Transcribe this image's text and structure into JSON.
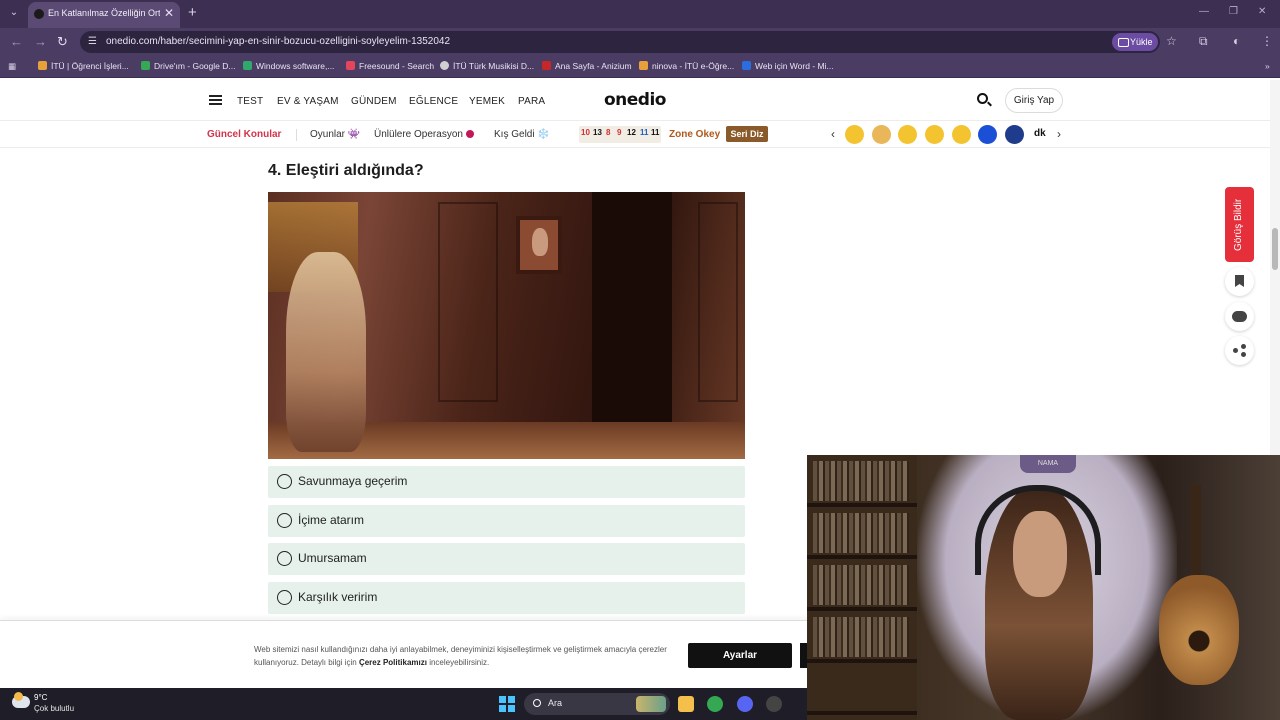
{
  "browser": {
    "tab_title": "En Katlanılmaz Özelliğin Ortaya",
    "tab_close": "✕",
    "new_tab": "+",
    "url": "onedio.com/haber/secimini-yap-en-sinir-bozucu-ozelligini-soyleyelim-1352042",
    "upload_label": "Yükle",
    "bookmarks": [
      {
        "label": "İTÜ | Öğrenci İşleri...",
        "color": "#e8a13a"
      },
      {
        "label": "Drive'ım - Google D...",
        "color": "#34a853"
      },
      {
        "label": "Windows software,...",
        "color": "#2ea86b"
      },
      {
        "label": "Freesound - Search",
        "color": "#e2455c"
      },
      {
        "label": "İTÜ Türk Musikisi D...",
        "color": "#d0d0d0"
      },
      {
        "label": "Ana Sayfa - Anizium",
        "color": "#c62828"
      },
      {
        "label": "ninova - İTÜ e-Öğre...",
        "color": "#e8a13a"
      },
      {
        "label": "Web için Word - Mi...",
        "color": "#2b6de0"
      }
    ]
  },
  "site": {
    "logo": "onedio",
    "nav": [
      "TEST",
      "EV & YAŞAM",
      "GÜNDEM",
      "EĞLENCE",
      "YEMEK",
      "PARA"
    ],
    "login_label": "Giriş Yap",
    "subnav": {
      "current_topics": "Güncel Konular",
      "games": "Oyunlar 👾",
      "celebrity_op": "Ünlülere Operasyon",
      "winter": "Kış Geldi ❄️",
      "okey_tiles": [
        {
          "n": "10",
          "c": "#d32f2f"
        },
        {
          "n": "13",
          "c": "#111111"
        },
        {
          "n": "8",
          "c": "#d32f2f"
        },
        {
          "n": "9",
          "c": "#d32f2f"
        },
        {
          "n": "12",
          "c": "#111111"
        },
        {
          "n": "11",
          "c": "#1e5fbf"
        },
        {
          "n": "11",
          "c": "#111111"
        }
      ],
      "zone_okey": "Zone Okey",
      "seri_diz": "Seri Diz",
      "prev": "‹",
      "next": "›",
      "emojis": [
        {
          "name": "gamepad-emoji-icon",
          "color": "#f4c430"
        },
        {
          "name": "paw-emoji-icon",
          "color": "#e9b65a"
        },
        {
          "name": "heart-eyes-emoji-icon",
          "color": "#f4c430"
        },
        {
          "name": "sad-emoji-icon",
          "color": "#f4c430"
        },
        {
          "name": "smile-emoji-icon",
          "color": "#f4c430"
        },
        {
          "name": "brand-blue-icon",
          "color": "#1a4fd6"
        },
        {
          "name": "brand-navy-icon",
          "color": "#1f3b8c"
        },
        {
          "name": "dk-brand-icon",
          "color": "#ffffff"
        }
      ],
      "dk_label": "dk"
    }
  },
  "question": {
    "title": "4. Eleştiri aldığında?",
    "options": [
      "Savunmaya geçerim",
      "İçime atarım",
      "Umursamam",
      "Karşılık veririm"
    ]
  },
  "sidebar": {
    "feedback_label": "Görüş Bildir"
  },
  "cookie": {
    "text_before": "Web sitemizi nasıl kullandığınızı daha iyi anlayabilmek, deneyiminizi kişiselleştirmek ve geliştirmek amacıyla çerezler kullanıyoruz. Detaylı bilgi için ",
    "policy_link": "Çerez Politikamızı",
    "text_after": " inceleyebilirsiniz.",
    "settings_button": "Ayarlar"
  },
  "webcam": {
    "chair_logo": "NAMA"
  },
  "taskbar": {
    "temperature": "9°C",
    "condition": "Çok bulutlu",
    "search_label": "Ara",
    "apps": [
      {
        "name": "file-explorer-icon",
        "color": "#f3c04b"
      },
      {
        "name": "chrome-icon",
        "color": "#34a853"
      },
      {
        "name": "discord-icon",
        "color": "#5865f2"
      },
      {
        "name": "obs-icon",
        "color": "#444444"
      }
    ]
  },
  "colors": {
    "accent_red": "#e5303c",
    "option_bg": "#e5f1ea",
    "browser_frame": "#4b3c63"
  }
}
